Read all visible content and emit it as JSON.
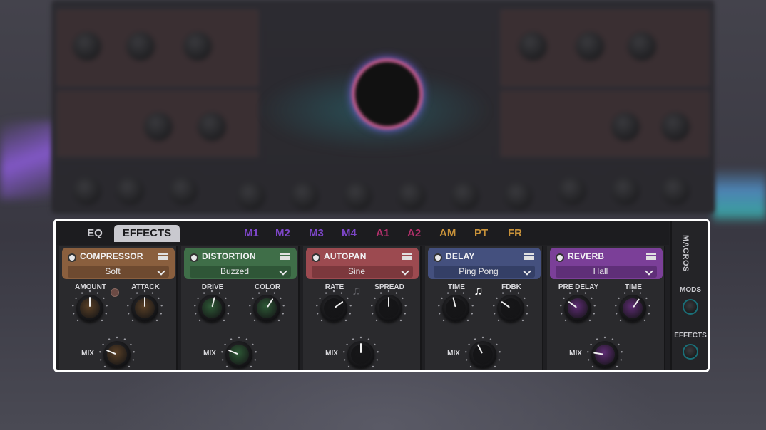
{
  "tabs": {
    "eq": "EQ",
    "effects": "EFFECTS"
  },
  "mod_tabs": [
    {
      "label": "M1",
      "color": "#7d46c8"
    },
    {
      "label": "M2",
      "color": "#7d46c8"
    },
    {
      "label": "M3",
      "color": "#7d46c8"
    },
    {
      "label": "M4",
      "color": "#7d46c8"
    },
    {
      "label": "A1",
      "color": "#b0306a"
    },
    {
      "label": "A2",
      "color": "#b0306a"
    },
    {
      "label": "AM",
      "color": "#c8923a"
    },
    {
      "label": "PT",
      "color": "#c8923a"
    },
    {
      "label": "FR",
      "color": "#c8923a"
    }
  ],
  "slots": [
    {
      "title": "COMPRESSOR",
      "mode": "Soft",
      "head_color": "#8a5f3e",
      "select_color": "#6e4a30",
      "knob_color": "#5a4026",
      "knob_labels": {
        "a": "AMOUNT",
        "b": "ATTACK",
        "mix": "MIX"
      },
      "knob_values": {
        "a": 0.5,
        "b": 0.5,
        "mix": 0.25
      }
    },
    {
      "title": "DISTORTION",
      "mode": "Buzzed",
      "head_color": "#3f6e48",
      "select_color": "#2f5637",
      "knob_color": "#2e5a36",
      "knob_labels": {
        "a": "DRIVE",
        "b": "COLOR",
        "mix": "MIX"
      },
      "knob_values": {
        "a": 0.55,
        "b": 0.62,
        "mix": 0.25
      }
    },
    {
      "title": "AUTOPAN",
      "mode": "Sine",
      "head_color": "#9c4a50",
      "select_color": "#7c383d",
      "knob_color": "#161618",
      "knob_labels": {
        "a": "RATE",
        "b": "SPREAD",
        "mix": "MIX"
      },
      "knob_values": {
        "a": 0.7,
        "b": 0.5,
        "mix": 0.5
      }
    },
    {
      "title": "DELAY",
      "mode": "Ping Pong",
      "head_color": "#44507e",
      "select_color": "#343f66",
      "knob_color": "#161618",
      "knob_labels": {
        "a": "TIME",
        "b": "FDBK",
        "mix": "MIX"
      },
      "knob_values": {
        "a": 0.45,
        "b": 0.3,
        "mix": 0.4
      }
    },
    {
      "title": "REVERB",
      "mode": "Hall",
      "head_color": "#7b3f98",
      "select_color": "#5f2f78",
      "knob_color": "#5e2c74",
      "knob_labels": {
        "a": "PRE DELAY",
        "b": "TIME",
        "mix": "MIX"
      },
      "knob_values": {
        "a": 0.3,
        "b": 0.63,
        "mix": 0.2
      }
    }
  ],
  "sidebar": {
    "title": "MACROS",
    "mods_label": "MODS",
    "effects_label": "EFFECTS"
  },
  "icons": {
    "sync_icon": "music-note-icon"
  }
}
